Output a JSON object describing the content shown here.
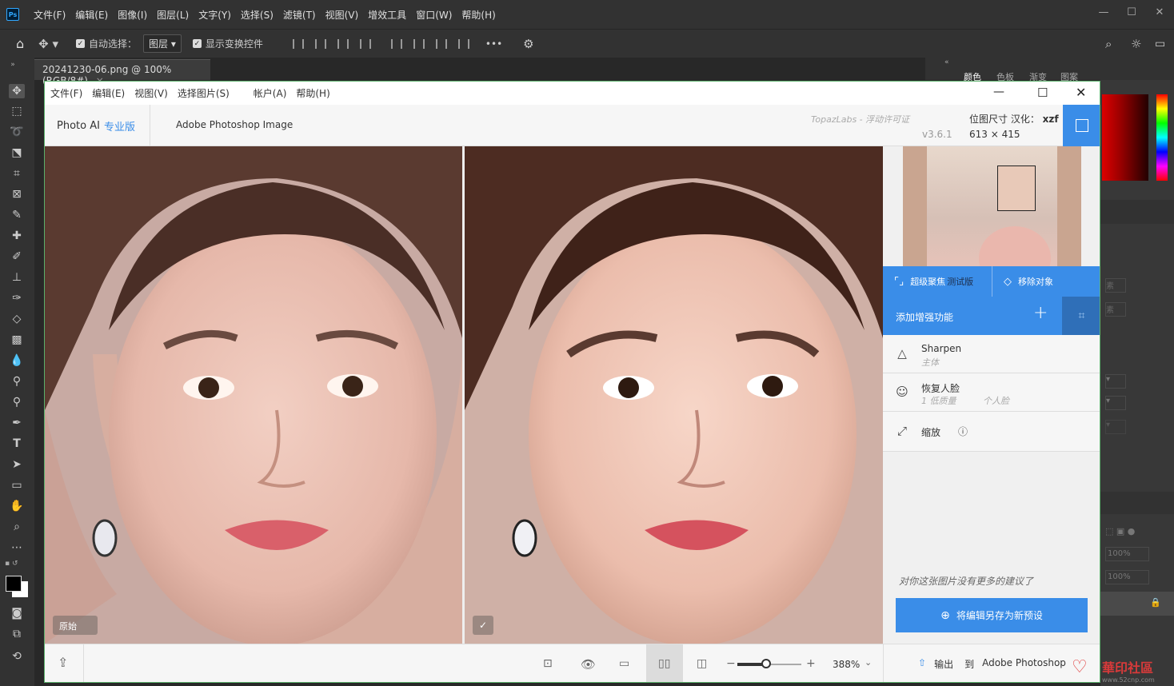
{
  "photoshop": {
    "logo": "Ps",
    "menu": [
      "文件(F)",
      "编辑(E)",
      "图像(I)",
      "图层(L)",
      "文字(Y)",
      "选择(S)",
      "滤镜(T)",
      "视图(V)",
      "增效工具",
      "窗口(W)",
      "帮助(H)"
    ],
    "options": {
      "auto_select_label": "自动选择：",
      "layer_select_value": "图层",
      "show_transform_label": "显示变换控件"
    },
    "document_tab": "20241230-06.png @ 100%(RGB/8#)",
    "right_panel_tabs": [
      "颜色",
      "色板",
      "渐变",
      "图案"
    ],
    "panel_values": [
      "100%",
      "100%"
    ]
  },
  "topaz": {
    "menu": [
      "文件(F)",
      "编辑(E)",
      "视图(V)",
      "选择图片(S)",
      "帐户(A)",
      "帮助(H)"
    ],
    "brand": "Photo AI",
    "brand_edition": "专业版",
    "document_name": "Adobe Photoshop Image",
    "license_text": "TopazLabs - 浮动许可证",
    "version": "v3.6.1",
    "size_label": "位图尺寸 汉化：",
    "size_author": "xzf",
    "dimensions": "613 × 415",
    "super_focus_label": "超级聚焦",
    "super_focus_badge": "测试版",
    "remove_object_label": "移除对象",
    "add_enhancement_label": "添加增强功能",
    "features": [
      {
        "title": "Sharpen",
        "sub": "主体",
        "sub2": "",
        "icon": "triangle-icon"
      },
      {
        "title": "恢复人脸",
        "sub": "1 低质量",
        "sub2": "个人脸",
        "icon": "face-icon"
      },
      {
        "title": "缩放",
        "sub": "",
        "sub2": "",
        "icon": "expand-icon"
      }
    ],
    "suggestion": "对你这张图片没有更多的建议了",
    "save_preset_label": "将编辑另存为新预设",
    "original_label": "原始",
    "check_label": "✓",
    "zoom_value": "388%",
    "export_label": "输出",
    "export_target_prefix": "到",
    "export_target": "Adobe Photoshop"
  },
  "watermark": "華印社區",
  "watermark_url": "www.52cnp.com"
}
